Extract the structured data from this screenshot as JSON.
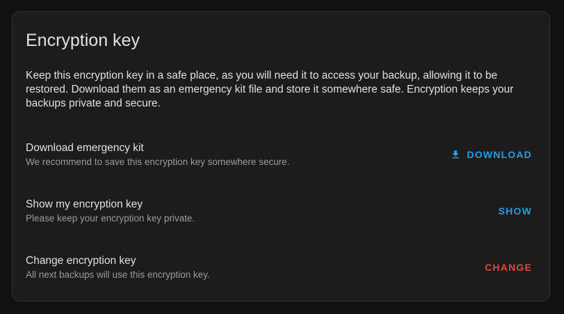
{
  "dialog": {
    "title": "Encryption key",
    "description": "Keep this encryption key in a safe place, as you will need it to access your backup, allowing it to be restored. Download them as an emergency kit file and store it somewhere safe. Encryption keeps your backups private and secure."
  },
  "rows": [
    {
      "title": "Download emergency kit",
      "subtitle": "We recommend to save this encryption key somewhere secure.",
      "action_label": "DOWNLOAD",
      "action_icon": "download-icon",
      "action_color": "#1fa0e8"
    },
    {
      "title": "Show my encryption key",
      "subtitle": "Please keep your encryption key private.",
      "action_label": "SHOW",
      "action_color": "#1fa0e8"
    },
    {
      "title": "Change encryption key",
      "subtitle": "All next backups will use this encryption key.",
      "action_label": "CHANGE",
      "action_color": "#e0493c"
    }
  ],
  "colors": {
    "background": "#111111",
    "card": "#1c1c1c",
    "text_primary": "#e1e1e1",
    "text_secondary": "#9b9b9b",
    "accent": "#1fa0e8",
    "warning": "#e0493c"
  }
}
